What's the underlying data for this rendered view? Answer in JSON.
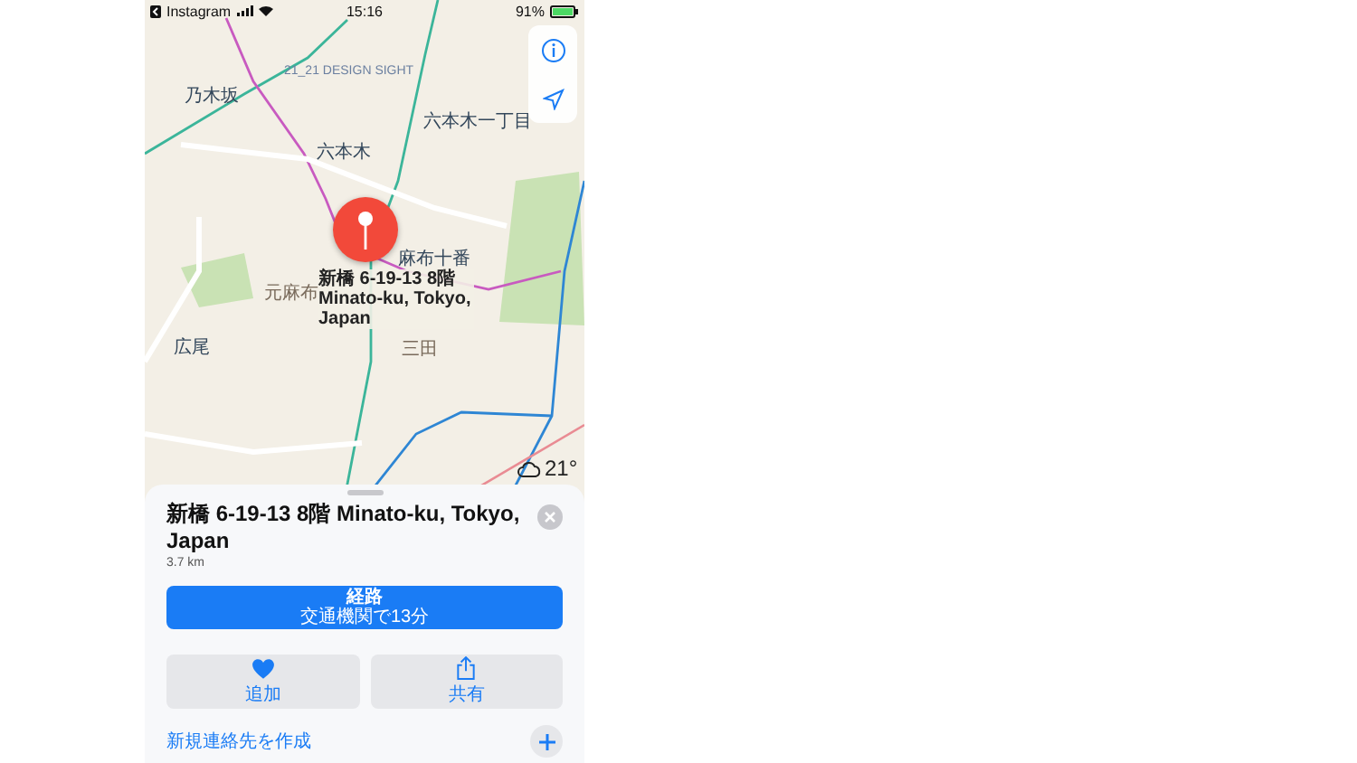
{
  "status_bar": {
    "back_app": "Instagram",
    "time": "15:16",
    "battery": "91%"
  },
  "map": {
    "labels": [
      {
        "text": "乃木坂",
        "kind": "station"
      },
      {
        "text": "21_21 DESIGN SIGHT",
        "kind": "place"
      },
      {
        "text": "六本木",
        "kind": "station"
      },
      {
        "text": "六本木一丁目",
        "kind": "station"
      },
      {
        "text": "麻布十番",
        "kind": "station"
      },
      {
        "text": "元麻布",
        "kind": "area"
      },
      {
        "text": "広尾",
        "kind": "station"
      },
      {
        "text": "三田",
        "kind": "area"
      }
    ],
    "pin_label": "新橋 6-19-13 8階 Minato-ku, Tokyo, Japan",
    "weather": "21°"
  },
  "place": {
    "title": "新橋 6-19-13 8階 Minato-ku, Tokyo, Japan",
    "distance": "3.7 km",
    "directions": {
      "label": "経路",
      "detail": "交通機関で13分"
    },
    "actions": [
      {
        "label": "追加",
        "kind": "favorite"
      },
      {
        "label": "共有",
        "kind": "share"
      }
    ],
    "create_contact": "新規連絡先を作成"
  }
}
